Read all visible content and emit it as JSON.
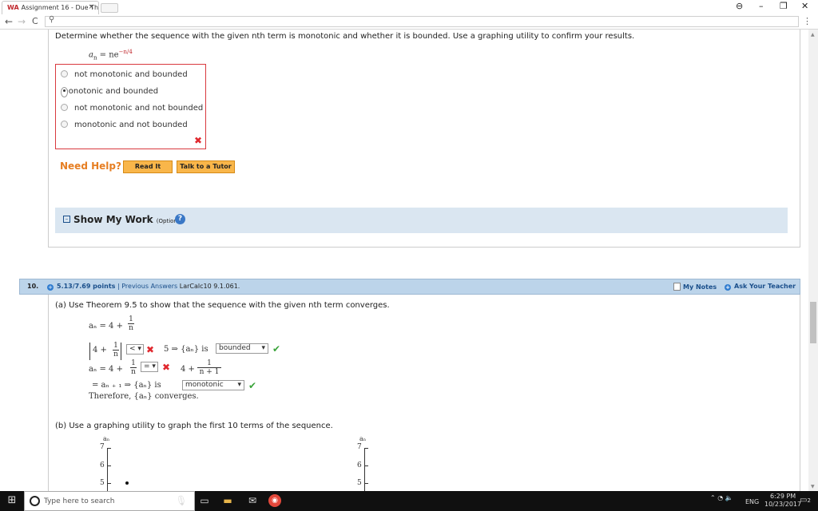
{
  "browser": {
    "tab_title": "Assignment 16 - Due Th",
    "tab_favicon": "WA",
    "tab_close": "×",
    "window_controls": [
      "⊖",
      "–",
      "❐",
      "✕"
    ],
    "nav": {
      "back": "←",
      "forward": "→",
      "reload": "C"
    },
    "omnibox_value": "",
    "menu": "⋮"
  },
  "q9": {
    "prompt": "Determine whether the sequence with the given nth term is monotonic and whether it is bounded. Use a graphing utility to confirm your results.",
    "formula_lhs": "a",
    "formula_sub": "n",
    "formula_rhs": " = ne",
    "formula_exp": "−n/4",
    "choices": [
      {
        "label": "not monotonic and bounded",
        "selected": false
      },
      {
        "label": "monotonic and bounded",
        "selected": true
      },
      {
        "label": "not monotonic and not bounded",
        "selected": false
      },
      {
        "label": "monotonic and not bounded",
        "selected": false
      }
    ],
    "result_mark": "✖",
    "need_help": "Need Help?",
    "read_it": "Read It",
    "talk_tutor": "Talk to a Tutor",
    "show_my_work": "Show My Work",
    "optional": "(Optional)",
    "help_icon": "?",
    "toggle": "–"
  },
  "q10": {
    "number": "10.",
    "points": "5.13/7.69 points",
    "prev_answers": "| Previous Answers",
    "code": "LarCalc10 9.1.061.",
    "my_notes": "My Notes",
    "ask_teacher": "Ask Your Teacher",
    "part_a": "(a) Use Theorem 9.5 to show that the sequence with the given nth term converges.",
    "an_def": "aₙ = 4 +",
    "frac1_num": "1",
    "frac1_den": "n",
    "abs_expr": "4 +",
    "select1": "<",
    "mark1": "✖",
    "five_text": "5 ⇒ {aₙ} is",
    "select_bounded": "bounded",
    "check1": "✔",
    "an_line2": "aₙ = 4 +",
    "select2": "=",
    "mark2": "✖",
    "rhs2": "4 +",
    "frac2_num": "1",
    "frac2_den": "n + 1",
    "line3": "= aₙ ₊ ₁ ⇒ {aₙ} is",
    "select_monotonic": "monotonic",
    "check2": "✔",
    "therefore": "Therefore, {aₙ} converges.",
    "part_b": "(b) Use a graphing utility to graph the first 10 terms of the sequence.",
    "graph_label": "aₙ",
    "ticks": [
      "7",
      "6",
      "5"
    ]
  },
  "taskbar": {
    "search_placeholder": "Type here to search",
    "time": "6:29 PM",
    "date": "10/23/2017",
    "lang": "ENG",
    "notif_count": "2"
  }
}
